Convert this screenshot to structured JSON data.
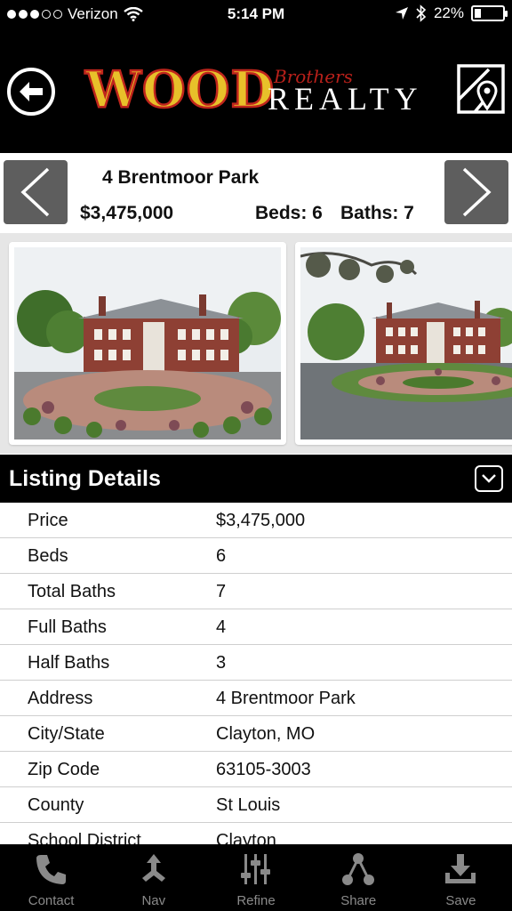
{
  "status_bar": {
    "carrier": "Verizon",
    "time": "5:14 PM",
    "battery": "22%",
    "battery_level": 0.22
  },
  "header": {
    "logo_word": "WOOD",
    "logo_brothers": "Brothers",
    "logo_realty": "REALTY",
    "back_icon": "back-arrow-icon",
    "map_icon": "map-pin-icon"
  },
  "property": {
    "address": "4 Brentmoor Park",
    "price": "$3,475,000",
    "beds": "Beds: 6",
    "baths": "Baths: 7"
  },
  "details": {
    "title": "Listing Details",
    "rows": [
      {
        "label": "Price",
        "value": "$3,475,000"
      },
      {
        "label": "Beds",
        "value": "6"
      },
      {
        "label": "Total Baths",
        "value": "7"
      },
      {
        "label": "Full Baths",
        "value": "4"
      },
      {
        "label": "Half Baths",
        "value": "3"
      },
      {
        "label": "Address",
        "value": "4 Brentmoor Park"
      },
      {
        "label": "City/State",
        "value": "Clayton, MO"
      },
      {
        "label": "Zip Code",
        "value": "63105-3003"
      },
      {
        "label": "County",
        "value": "St Louis"
      },
      {
        "label": "School District",
        "value": "Clayton"
      }
    ]
  },
  "toolbar": {
    "items": [
      {
        "label": "Contact",
        "icon": "phone-icon"
      },
      {
        "label": "Nav",
        "icon": "navigation-icon"
      },
      {
        "label": "Refine",
        "icon": "sliders-icon"
      },
      {
        "label": "Share",
        "icon": "share-icon"
      },
      {
        "label": "Save",
        "icon": "download-icon"
      }
    ]
  },
  "colors": {
    "header_bg": "#000000",
    "logo_yellow": "#e8c02a",
    "logo_red": "#c0251c",
    "nav_arrow_bg": "#5e5e5e",
    "toolbar_label": "#8a8a8a"
  }
}
